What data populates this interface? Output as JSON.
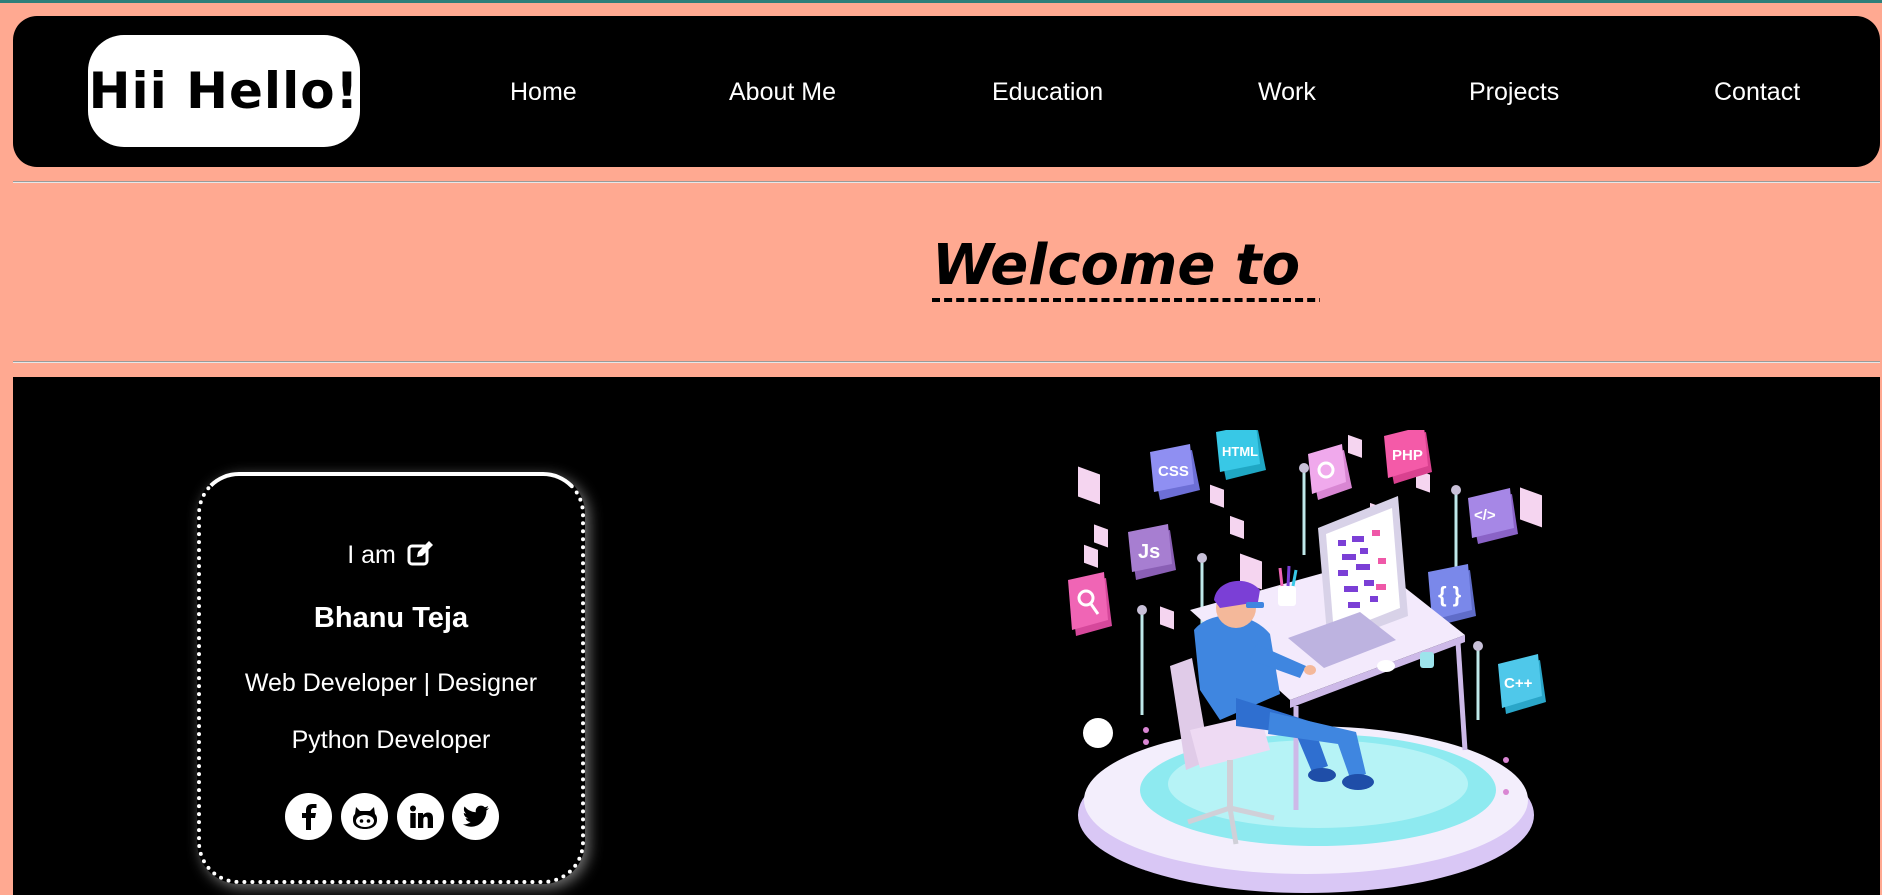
{
  "header": {
    "logo_text": "Hii Hello!",
    "nav": [
      {
        "label": "Home"
      },
      {
        "label": "About Me"
      },
      {
        "label": "Education"
      },
      {
        "label": "Work"
      },
      {
        "label": "Projects"
      },
      {
        "label": "Contact"
      }
    ]
  },
  "welcome": {
    "text": "Welcome to My"
  },
  "intro_card": {
    "iam_label": "I am",
    "name": "Bhanu Teja",
    "role_line1": "Web Developer | Designer",
    "role_line2": "Python Developer",
    "social_icons": [
      "facebook-icon",
      "github-icon",
      "linkedin-icon",
      "twitter-icon"
    ]
  },
  "illustration": {
    "badges": [
      "CSS",
      "HTML",
      "PHP",
      "Js",
      "</>",
      "{ }",
      "C++"
    ]
  },
  "colors": {
    "page_background": "#ffa991",
    "navbar": "#000000",
    "accent_teal": "#2f7f7a"
  }
}
